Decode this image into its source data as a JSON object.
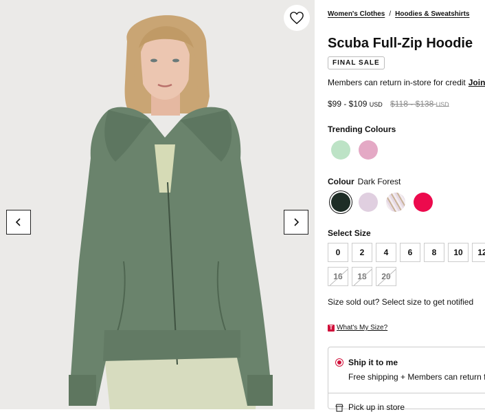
{
  "breadcrumbs": [
    "Women's Clothes",
    "Hoodies & Sweatshirts"
  ],
  "breadcrumb_separator": "/",
  "product": {
    "title": "Scuba Full-Zip Hoodie",
    "badge": "FINAL SALE",
    "member_note": "Members can return in-store for credit",
    "join_label": "Join",
    "price_range": "$99 - $109",
    "price_currency": "USD",
    "was_price": "$118 - $138",
    "was_currency": "USD"
  },
  "trending": {
    "label": "Trending Colours",
    "swatches": [
      {
        "name": "mint",
        "color": "#bde3c6"
      },
      {
        "name": "pink",
        "color": "#e4a9c5"
      }
    ]
  },
  "colour": {
    "label": "Colour",
    "selected": "Dark Forest",
    "swatches": [
      {
        "name": "dark-forest",
        "color": "#1e2d26",
        "selected": true
      },
      {
        "name": "lilac",
        "color": "#e0cfe0",
        "selected": false
      },
      {
        "name": "stripe",
        "color": "#e6d9e4",
        "selected": false
      },
      {
        "name": "red",
        "color": "#ec0a4d",
        "selected": false
      }
    ]
  },
  "size": {
    "label": "Select Size",
    "available": [
      "0",
      "2",
      "4",
      "6",
      "8",
      "10",
      "12"
    ],
    "sold_out": [
      "16",
      "18",
      "20"
    ],
    "sold_out_note": "Size sold out? Select size to get notified",
    "guide_label": "What's My Size?",
    "guide_badge": "T"
  },
  "shipping": {
    "ship_title": "Ship it to me",
    "ship_subtitle": "Free shipping + Members can return fo",
    "pickup_title": "Pick up in store"
  },
  "icons": {
    "favorite": "heart-icon",
    "prev": "chevron-left-icon",
    "next": "chevron-right-icon",
    "store": "store-icon"
  }
}
